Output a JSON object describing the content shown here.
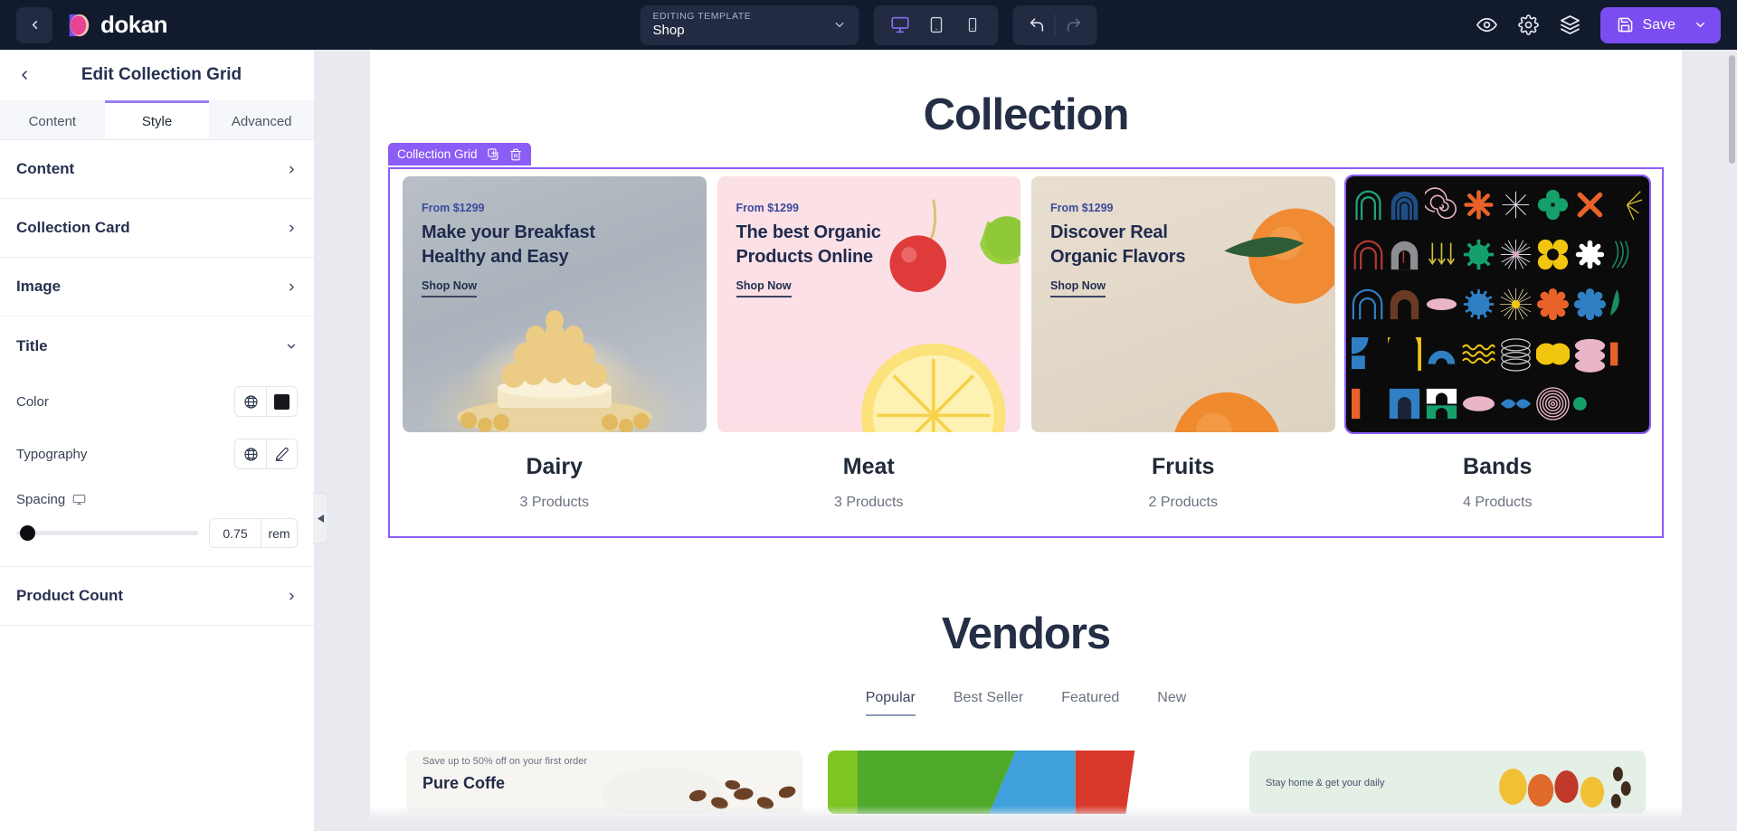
{
  "topbar": {
    "back_icon": "chevron-left-icon",
    "brand": "dokan",
    "template_kicker": "EDITING TEMPLATE",
    "template_value": "Shop",
    "devices": [
      {
        "name": "desktop",
        "active": true
      },
      {
        "name": "tablet",
        "active": false
      },
      {
        "name": "mobile",
        "active": false
      }
    ],
    "undo_icon": "undo-icon",
    "redo_icon": "redo-icon",
    "preview_icon": "eye-icon",
    "settings_icon": "gear-icon",
    "layers_icon": "layers-icon",
    "save_label": "Save",
    "save_icon": "floppy-disk-icon",
    "save_caret_icon": "chevron-down-icon",
    "accent": "#7b4df0",
    "bar_bg": "#121a2e"
  },
  "panel": {
    "back_icon": "chevron-left-icon",
    "title": "Edit Collection Grid",
    "tabs": [
      {
        "label": "Content",
        "active": false
      },
      {
        "label": "Style",
        "active": true
      },
      {
        "label": "Advanced",
        "active": false
      }
    ],
    "sections": [
      {
        "label": "Content",
        "state": "collapsed",
        "chevron": "chevron-right-icon"
      },
      {
        "label": "Collection Card",
        "state": "collapsed",
        "chevron": "chevron-right-icon"
      },
      {
        "label": "Image",
        "state": "collapsed",
        "chevron": "chevron-right-icon"
      },
      {
        "label": "Title",
        "state": "expanded",
        "chevron": "chevron-down-icon"
      },
      {
        "label": "Product Count",
        "state": "collapsed",
        "chevron": "chevron-right-icon"
      }
    ],
    "title_section": {
      "color_label": "Color",
      "color_globe_icon": "globe-icon",
      "color_value": "#17181c",
      "typography_label": "Typography",
      "typography_globe_icon": "globe-icon",
      "typography_edit_icon": "pencil-icon",
      "spacing_label": "Spacing",
      "spacing_device_icon": "monitor-icon",
      "spacing_value": "0.75",
      "spacing_unit": "rem",
      "spacing_percent": 2
    },
    "collapse_icon": "triangle-left-icon"
  },
  "canvas": {
    "collection_heading": "Collection",
    "widget_badge": {
      "label": "Collection Grid",
      "duplicate_icon": "duplicate-icon",
      "delete_icon": "trash-icon",
      "color": "#8b5cf6"
    },
    "cards": [
      {
        "price": "From $1299",
        "headline_line1": "Make your Breakfast",
        "headline_line2": "Healthy and Easy",
        "cta": "Shop Now",
        "category": "Dairy",
        "count": "3 Products",
        "image": "dairy-pastry-photo",
        "selected": false
      },
      {
        "price": "From $1299",
        "headline_line1": "The best Organic",
        "headline_line2": "Products Online",
        "cta": "Shop Now",
        "category": "Meat",
        "count": "3 Products",
        "image": "pink-citrus-photo",
        "selected": false
      },
      {
        "price": "From $1299",
        "headline_line1": "Discover Real",
        "headline_line2": "Organic Flavors",
        "cta": "Shop Now",
        "category": "Fruits",
        "count": "2 Products",
        "image": "beige-oranges-photo",
        "selected": false
      },
      {
        "price": "",
        "headline_line1": "",
        "headline_line2": "",
        "cta": "",
        "category": "Bands",
        "count": "4 Products",
        "image": "abstract-shapes-photo",
        "selected": true
      }
    ],
    "vendors_heading": "Vendors",
    "vendor_tabs": [
      {
        "label": "Popular",
        "active": true
      },
      {
        "label": "Best Seller",
        "active": false
      },
      {
        "label": "Featured",
        "active": false
      },
      {
        "label": "New",
        "active": false
      }
    ],
    "vendor_cards": [
      {
        "kicker": "Save up to 50% off on your first order",
        "title": "Pure Coffe"
      },
      {
        "kicker": "",
        "title": ""
      },
      {
        "kicker": "Stay home & get your daily",
        "title": ""
      }
    ]
  }
}
